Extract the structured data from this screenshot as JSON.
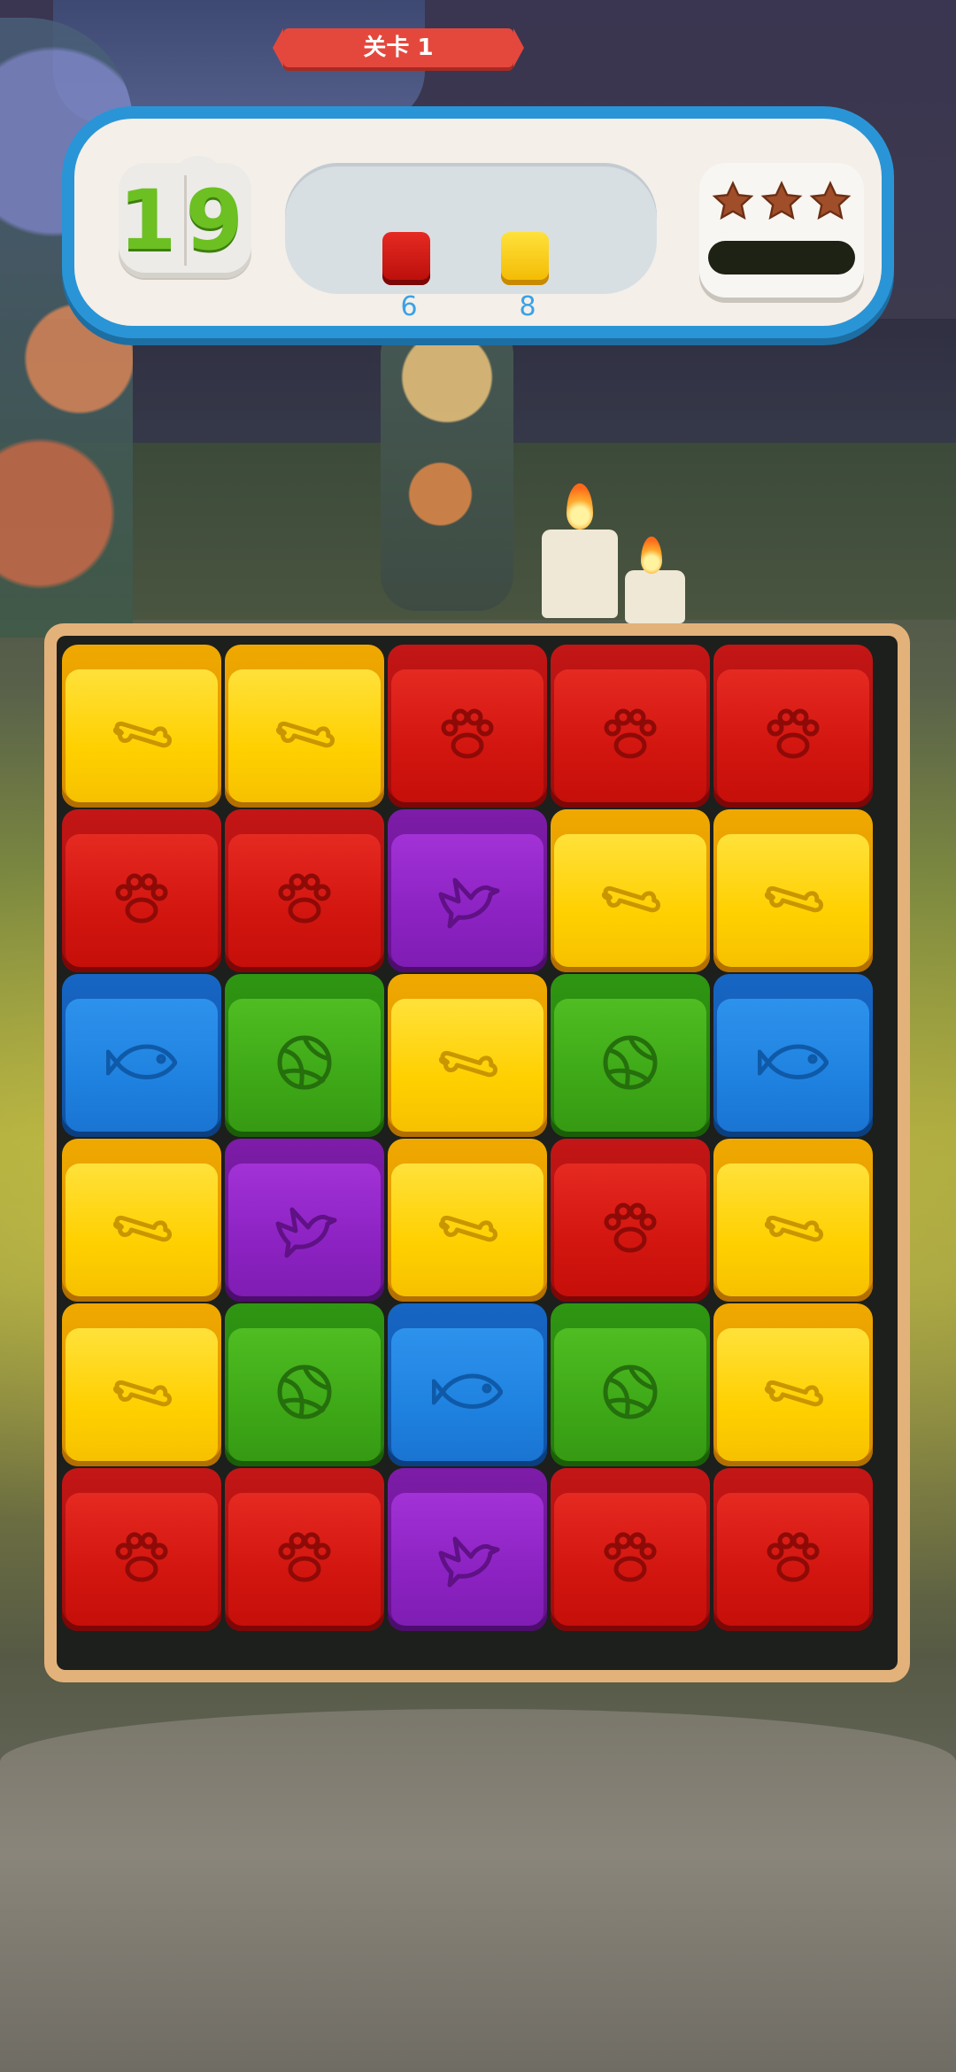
{
  "hud": {
    "moves_left": "19",
    "level_label": "关卡 1",
    "goals": [
      {
        "color": "red",
        "count": "6"
      },
      {
        "color": "yellow",
        "count": "8"
      }
    ],
    "stars_total": 3,
    "score_progress": 0
  },
  "colors": {
    "yellow": "#ffd000",
    "red": "#d2150f",
    "purple": "#8c22c2",
    "blue": "#1f82e0",
    "green": "#3ea817",
    "hud_frame": "#2a95d6",
    "level_ribbon": "#e4483d",
    "board_frame": "#e3b27a"
  },
  "board": {
    "columns": 5,
    "rows": 6,
    "cells": [
      [
        "yellow-bone",
        "yellow-bone",
        "red-paw",
        "red-paw",
        "red-paw"
      ],
      [
        "red-paw",
        "red-paw",
        "purple-bird",
        "yellow-bone",
        "yellow-bone"
      ],
      [
        "blue-fish",
        "green-ball",
        "yellow-bone",
        "green-ball",
        "blue-fish"
      ],
      [
        "yellow-bone",
        "purple-bird",
        "yellow-bone",
        "red-paw",
        "yellow-bone"
      ],
      [
        "yellow-bone",
        "green-ball",
        "blue-fish",
        "green-ball",
        "yellow-bone"
      ],
      [
        "red-paw",
        "red-paw",
        "purple-bird",
        "red-paw",
        "red-paw"
      ]
    ]
  },
  "icons": {
    "bone": "bone-icon",
    "paw": "paw-icon",
    "bird": "bird-icon",
    "fish": "fish-icon",
    "ball": "ball-icon",
    "star": "star-icon"
  }
}
